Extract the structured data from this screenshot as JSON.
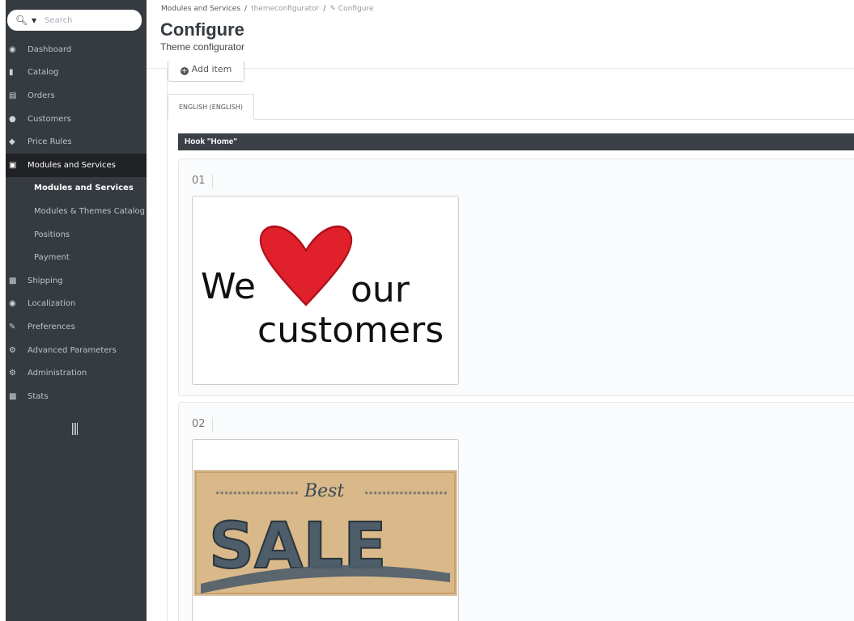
{
  "search": {
    "placeholder": "Search"
  },
  "sidebar": {
    "items": [
      {
        "label": "Dashboard",
        "icon": "dashboard-icon"
      },
      {
        "label": "Catalog",
        "icon": "book-icon"
      },
      {
        "label": "Orders",
        "icon": "credit-card-icon"
      },
      {
        "label": "Customers",
        "icon": "users-icon"
      },
      {
        "label": "Price Rules",
        "icon": "tags-icon"
      },
      {
        "label": "Modules and Services",
        "icon": "puzzle-icon",
        "active": true
      }
    ],
    "submenu": [
      {
        "label": "Modules and Services",
        "active": true
      },
      {
        "label": "Modules & Themes Catalog"
      },
      {
        "label": "Positions"
      },
      {
        "label": "Payment"
      }
    ],
    "items_after": [
      {
        "label": "Shipping",
        "icon": "truck-icon"
      },
      {
        "label": "Localization",
        "icon": "globe-icon"
      },
      {
        "label": "Preferences",
        "icon": "wrench-icon"
      },
      {
        "label": "Advanced Parameters",
        "icon": "cogs-icon"
      },
      {
        "label": "Administration",
        "icon": "cog-icon"
      },
      {
        "label": "Stats",
        "icon": "bar-chart-icon"
      }
    ]
  },
  "breadcrumb": {
    "part1": "Modules and Services",
    "part2": "themeconfigurator",
    "part3": "Configure"
  },
  "header": {
    "title": "Configure",
    "subtitle": "Theme configurator"
  },
  "content": {
    "add_item_label": "Add item",
    "tab_label": "ENGLISH (ENGLISH)",
    "hook_title": "Hook \"Home\"",
    "items": [
      {
        "number": "01",
        "image_text_1": "We",
        "image_text_2": "our",
        "image_text_3": "customers"
      },
      {
        "number": "02",
        "image_text_1": "Best",
        "image_text_2": "SALE"
      }
    ]
  },
  "colors": {
    "sidebar_bg": "#363a41",
    "sidebar_active": "#202226",
    "hook_bar": "#3b3f46",
    "heart": "#e0202a"
  }
}
